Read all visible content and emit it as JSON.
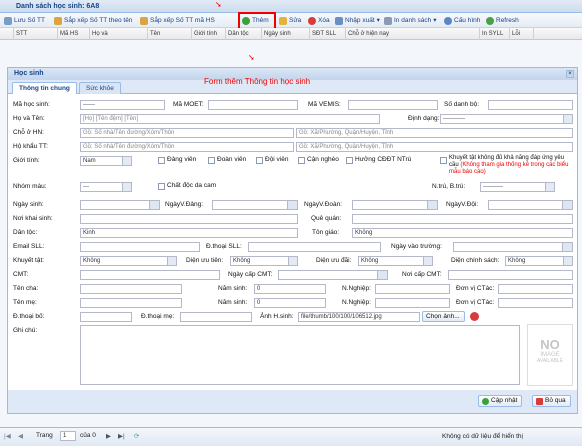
{
  "window": {
    "title": "Danh sách học sinh: 6A8"
  },
  "toolbar": {
    "save_order": "Lưu Số TT",
    "sort_name": "Sắp xếp Số TT theo tên",
    "sort_code": "Sắp xếp Số TT mã HS",
    "add": "Thêm",
    "edit": "Sửa",
    "delete": "Xóa",
    "import_export": "Nhập xuất",
    "print": "In danh sách",
    "config": "Cấu hình",
    "refresh": "Refresh"
  },
  "grid": {
    "columns": [
      "STT",
      "Mã HS",
      "Họ và",
      "Tên",
      "Giới tính",
      "Dân tộc",
      "Ngày sinh",
      "SĐT SLL",
      "Chỗ ở hiện nay",
      "In SYLL",
      "Lỗi"
    ]
  },
  "pager": {
    "page_label": "Trang",
    "page_value": "1",
    "of_label": "của 0",
    "status": "Không có dữ liệu để hiển thị"
  },
  "annotation": {
    "caption": "Form thêm Thông tin học sinh"
  },
  "dialog": {
    "title": "Học sinh",
    "tabs": [
      "Thông tin chung",
      "Sức khỏe"
    ],
    "labels": {
      "ma_hs": "Mã học sinh:",
      "ma_moet": "Mã MOET:",
      "ma_vemis": "Mã VEMIS:",
      "so_danh_bo": "Số danh bộ:",
      "ho_ten": "Họ và Tên:",
      "dinh_dang": "Định dạng:",
      "cho_o": "Chỗ ở HN:",
      "ho_khau": "Hộ khẩu TT:",
      "gioi_tinh": "Giới tính:",
      "dang_vien": "Đảng viên",
      "doan_vien": "Đoàn viên",
      "doi_vien": "Đội viên",
      "can_ngheo": "Cận nghèo",
      "huong_cbdt": "Hưởng CĐĐT NTrú",
      "khuyet_tat_note": "Khuyết tật không đủ khả năng đáp ứng yêu cầu",
      "khuyet_tat_red": "(Không tham gia thống kê trong các biểu mẫu báo cáo)",
      "nhom_mau": "Nhóm máu:",
      "chat_doc": "Chất độc da cam",
      "ntru_btru": "N.trú, B.trú:",
      "ngay_sinh": "Ngày sinh:",
      "ngay_dang": "NgàyV.Đảng:",
      "ngay_doan": "NgàyV.Đoàn:",
      "ngay_doi": "NgàyV.Đội:",
      "noi_khai_sinh": "Nơi khai sinh:",
      "que_quan": "Quê quán:",
      "dan_toc": "Dân tộc:",
      "ton_giao": "Tôn giáo:",
      "email": "Email SLL:",
      "dt_sll": "Đ.thoại SLL:",
      "ngay_vao_truong": "Ngày vào trường:",
      "khuyet_tat": "Khuyết tật:",
      "dien_uu_tien": "Diện ưu tiên:",
      "dien_uu_dai": "Diện ưu đãi:",
      "dien_chinh_sach": "Diện chính sách:",
      "cmt": "CMT:",
      "ngay_cap_cmt": "Ngày cấp CMT:",
      "noi_cap_cmt": "Nơi cấp CMT:",
      "ten_cha": "Tên cha:",
      "nam_sinh_cha": "Năm sinh:",
      "nnghiep_cha": "N.Nghiệp:",
      "don_vi_cha": "Đơn vị CTác:",
      "ten_me": "Tên mẹ:",
      "nam_sinh_me": "Năm sinh:",
      "nnghiep_me": "N.Nghiệp:",
      "don_vi_me": "Đơn vị CTác:",
      "dt_bo": "Đ.thoại bố:",
      "dt_me": "Đ.thoại mẹ:",
      "anh": "Ảnh H.sinh:",
      "ghi_chu": "Ghi chú:"
    },
    "values": {
      "ma_hs": "------",
      "ho_ten_ph": "[Họ] [Tên đệm] [Tên]",
      "dinh_dang": "-----------",
      "cho_o_ph1": "Gồ: Số nhà/Tên đường/Xóm/Thôn",
      "cho_o_ph2": "Gồ: Xã/Phường, Quận/Huyện, Tỉnh",
      "ho_khau_ph1": "Gồ: Số nhà/Tên đường/Xóm/Thôn",
      "ho_khau_ph2": "Gồ: Xã/Phường, Quận/Huyện, Tỉnh",
      "gioi_tinh": "Nam",
      "nhom_mau": "---",
      "ntru": "----------",
      "dan_toc": "Kinh",
      "ton_giao": "Không",
      "khuyet_tat": "Không",
      "dien_uu_tien": "Không",
      "dien_uu_dai": "Không",
      "dien_chinh_sach": "Không",
      "nam_sinh_cha": "0",
      "nam_sinh_me": "0",
      "anh": "file/thumb/100/100/106512.jpg"
    },
    "choose_photo": "Chọn ảnh...",
    "no_image": {
      "line1": "NO",
      "line2": "IMAGE",
      "line3": "AVAILABLE"
    },
    "buttons": {
      "update": "Cập nhật",
      "cancel": "Bỏ qua"
    }
  },
  "colors": {
    "accent": "#15428b",
    "annotation": "#e00000"
  }
}
